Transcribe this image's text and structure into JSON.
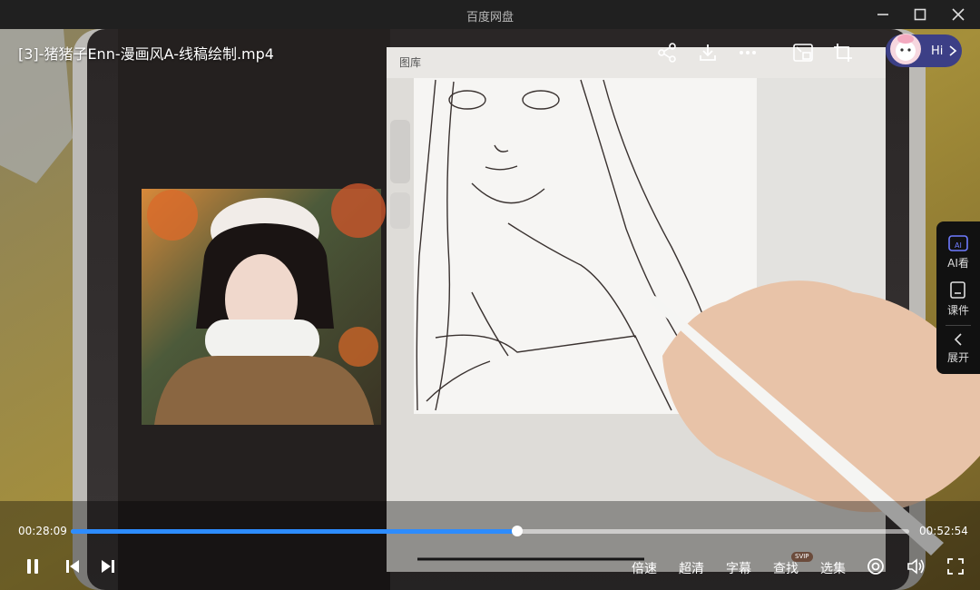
{
  "window": {
    "title": "百度网盘"
  },
  "video": {
    "title": "[3]-猪猪子Enn-漫画风A-线稿绘制.mp4",
    "progress": 0.533
  },
  "assistant": {
    "label": "Hi"
  },
  "side_panel": {
    "items": [
      {
        "label": "AI看",
        "icon": "ai-view-icon"
      },
      {
        "label": "课件",
        "icon": "courseware-icon"
      },
      {
        "label": "展开",
        "icon": "chevron-left-icon"
      }
    ]
  },
  "playback": {
    "current_time": "00:28:09",
    "total_time": "00:52:54"
  },
  "controls": {
    "speed": "倍速",
    "quality": "超清",
    "subtitle": "字幕",
    "search": "查找",
    "search_badge": "SVIP",
    "episodes": "选集"
  },
  "procreate": {
    "gallery": "图库"
  },
  "colors": {
    "accent": "#2d8cff",
    "assistant_bg": "#3c3f86"
  }
}
